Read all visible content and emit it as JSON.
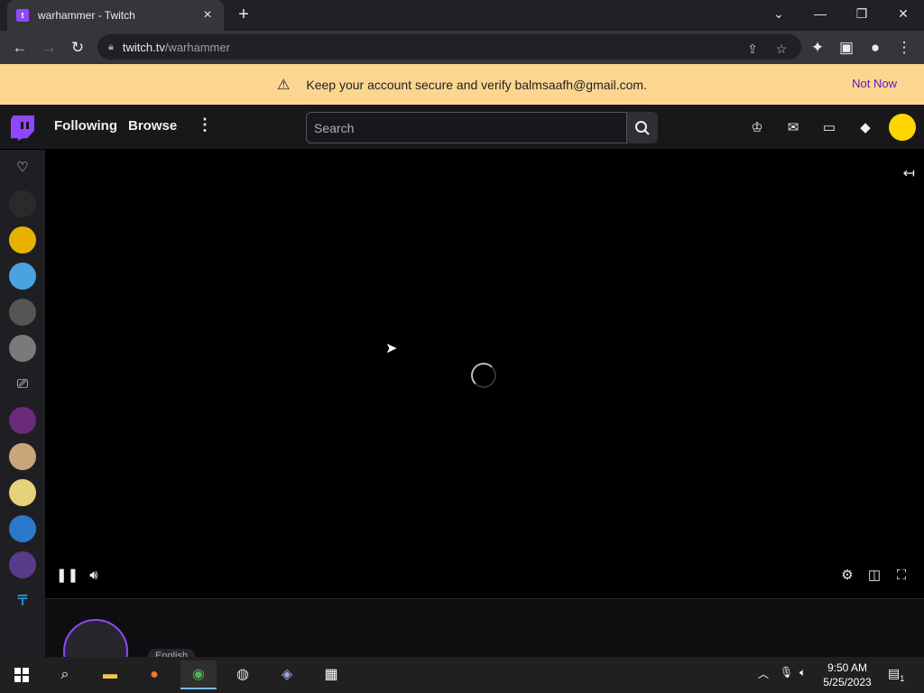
{
  "browser": {
    "tab_title": "warhammer - Twitch",
    "url_host": "twitch.tv",
    "url_path": "/warhammer"
  },
  "banner": {
    "message": "Keep your account secure and verify balmsaafh@gmail.com.",
    "action": "Not Now"
  },
  "twitch_nav": {
    "following": "Following",
    "browse": "Browse",
    "search_placeholder": "Search"
  },
  "player": {
    "state": "loading"
  },
  "channel": {
    "tag": "English"
  },
  "taskbar": {
    "time": "9:50 AM",
    "date": "5/25/2023",
    "notification_count": "1"
  },
  "colors": {
    "twitch_purple": "#9146ff",
    "banner_bg": "#fcd690",
    "page_bg": "#0e0e10"
  }
}
